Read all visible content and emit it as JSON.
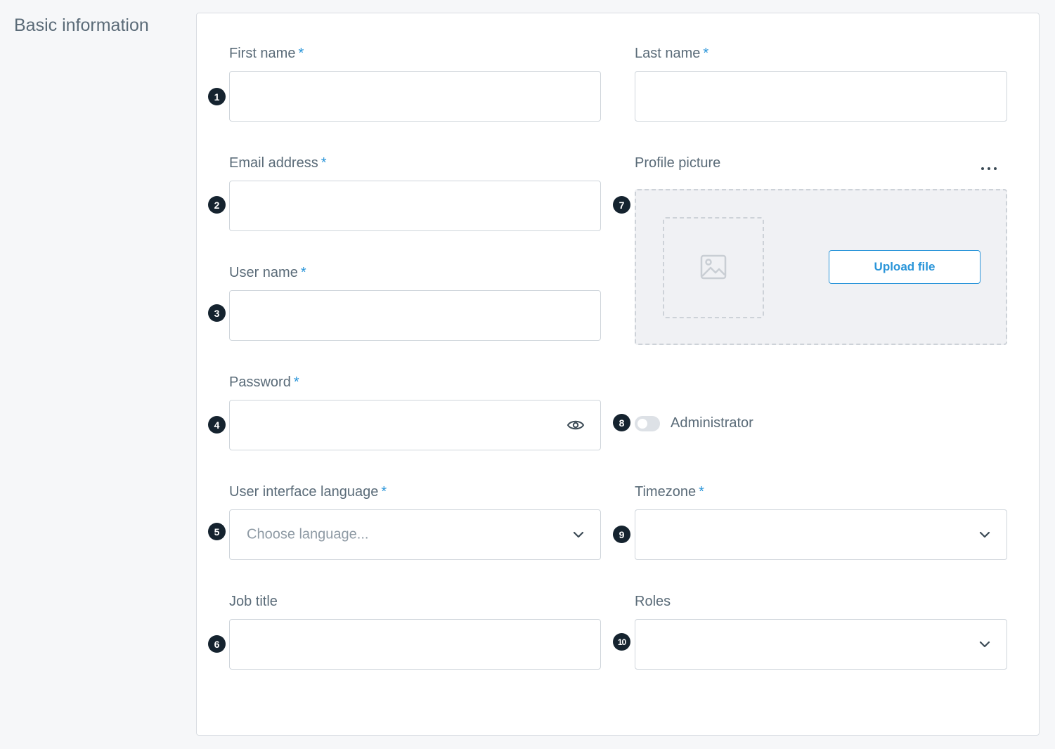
{
  "section": {
    "title": "Basic information"
  },
  "required_marker": "*",
  "fields": {
    "first_name": {
      "label": "First name",
      "value": "",
      "badge": "1"
    },
    "last_name": {
      "label": "Last name",
      "value": ""
    },
    "email": {
      "label": "Email address",
      "value": "",
      "badge": "2"
    },
    "profile_picture": {
      "label": "Profile picture",
      "badge": "7",
      "upload_label": "Upload file",
      "more_icon": "more-icon"
    },
    "user_name": {
      "label": "User name",
      "value": "",
      "badge": "3"
    },
    "password": {
      "label": "Password",
      "value": "",
      "badge": "4",
      "icon": "eye-icon"
    },
    "administrator": {
      "label": "Administrator",
      "badge": "8",
      "checked": false
    },
    "ui_language": {
      "label": "User interface language",
      "placeholder": "Choose language...",
      "badge": "5"
    },
    "timezone": {
      "label": "Timezone",
      "value": "",
      "badge": "9"
    },
    "job_title": {
      "label": "Job title",
      "value": "",
      "badge": "6"
    },
    "roles": {
      "label": "Roles",
      "value": "",
      "badge": "10"
    }
  },
  "colors": {
    "accent": "#2a95d9",
    "badge": "#15232f",
    "border": "#cfd5db",
    "background": "#f6f7f9"
  }
}
